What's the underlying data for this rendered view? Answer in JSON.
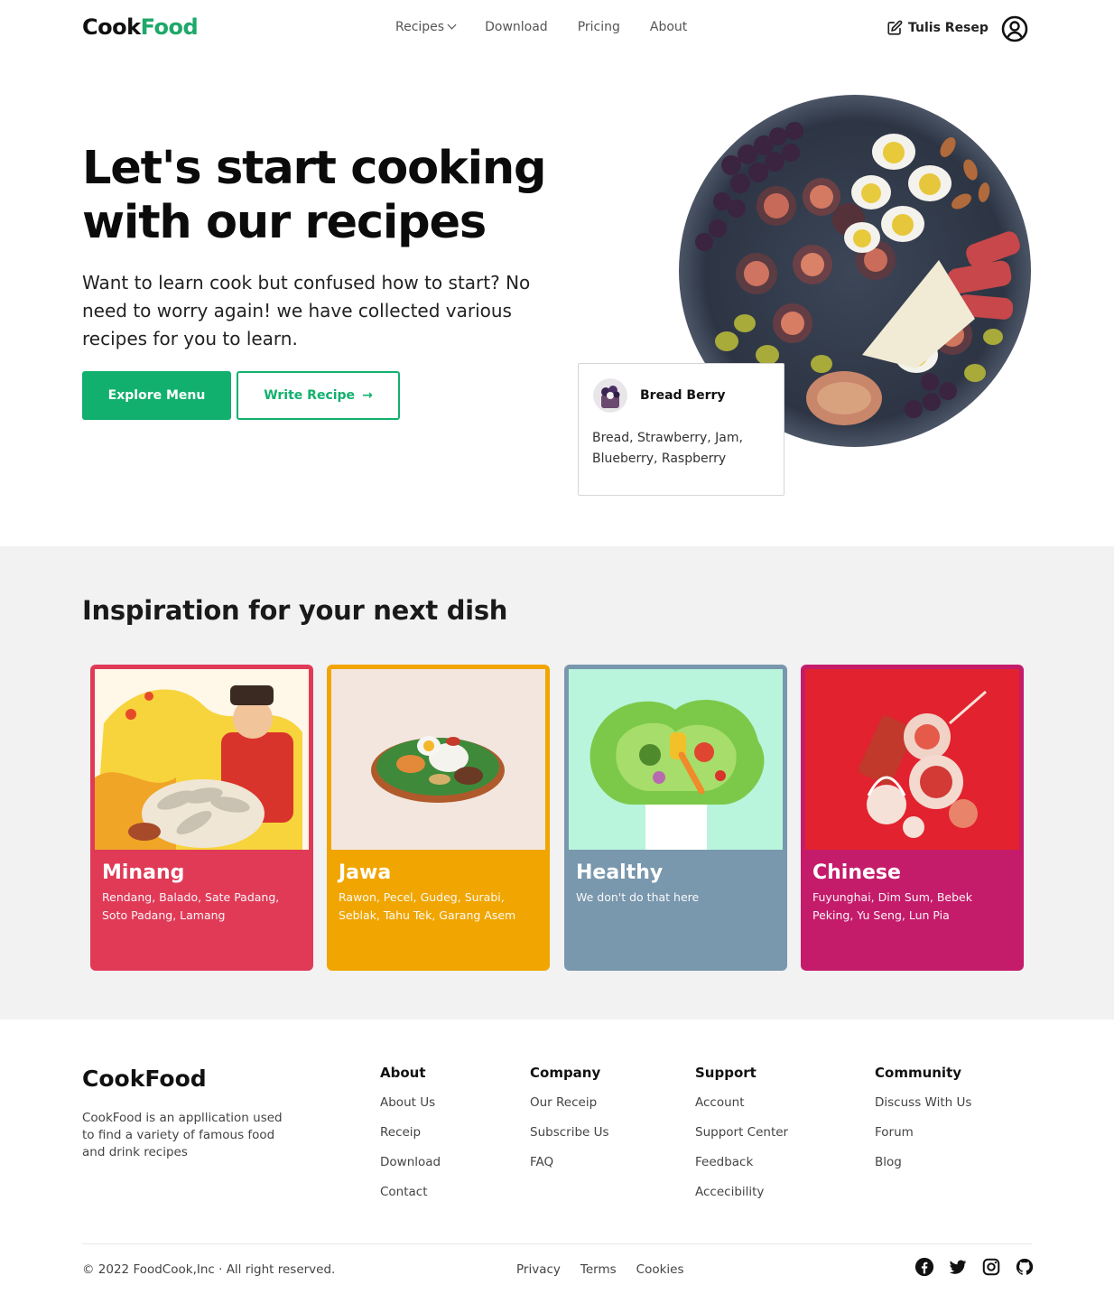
{
  "header": {
    "logo_part1": "Cook",
    "logo_part2": "Food",
    "nav": {
      "recipes": "Recipes",
      "download": "Download",
      "pricing": "Pricing",
      "about": "About"
    },
    "write_link": "Tulis Resep"
  },
  "hero": {
    "title": "Let's start cooking with our recipes",
    "description": "Want to learn cook but confused how to start? No need to worry again! we have collected various recipes for you to learn.",
    "explore_button": "Explore Menu",
    "write_button": "Write Recipe",
    "write_button_arrow": "→"
  },
  "recipe_card": {
    "name": "Bread Berry",
    "ingredients": "Bread, Strawberry, Jam, Blueberry, Raspberry"
  },
  "inspiration": {
    "title": "Inspiration for your next dish",
    "cards": [
      {
        "title": "Minang",
        "desc": "Rendang, Balado, Sate Padang, Soto Padang, Lamang",
        "color": "#e03a57"
      },
      {
        "title": "Jawa",
        "desc": "Rawon, Pecel, Gudeg, Surabi, Seblak, Tahu Tek, Garang Asem",
        "color": "#f0a500"
      },
      {
        "title": "Healthy",
        "desc": "We don't do that here",
        "color": "#7997ad"
      },
      {
        "title": "Chinese",
        "desc": "Fuyunghai, Dim Sum, Bebek Peking, Yu Seng, Lun Pia",
        "color": "#c41c6b"
      }
    ]
  },
  "footer": {
    "logo": "CookFood",
    "about_text": "CookFood is an appllication used to find a variety of famous food and drink recipes",
    "columns": [
      {
        "head": "About",
        "links": [
          "About Us",
          "Receip",
          "Download",
          "Contact"
        ]
      },
      {
        "head": "Company",
        "links": [
          "Our Receip",
          "Subscribe Us",
          "FAQ"
        ]
      },
      {
        "head": "Support",
        "links": [
          "Account",
          "Support Center",
          "Feedback",
          "Accecibility"
        ]
      },
      {
        "head": "Community",
        "links": [
          "Discuss With Us",
          "Forum",
          "Blog"
        ]
      }
    ],
    "copyright": "© 2022 FoodCook,Inc · All right reserved.",
    "legal": [
      "Privacy",
      "Terms",
      "Cookies"
    ],
    "socials": [
      "facebook-icon",
      "twitter-icon",
      "instagram-icon",
      "github-icon"
    ]
  },
  "colors": {
    "accent_green": "#12b06e",
    "section_bg": "#f2f2f2"
  }
}
